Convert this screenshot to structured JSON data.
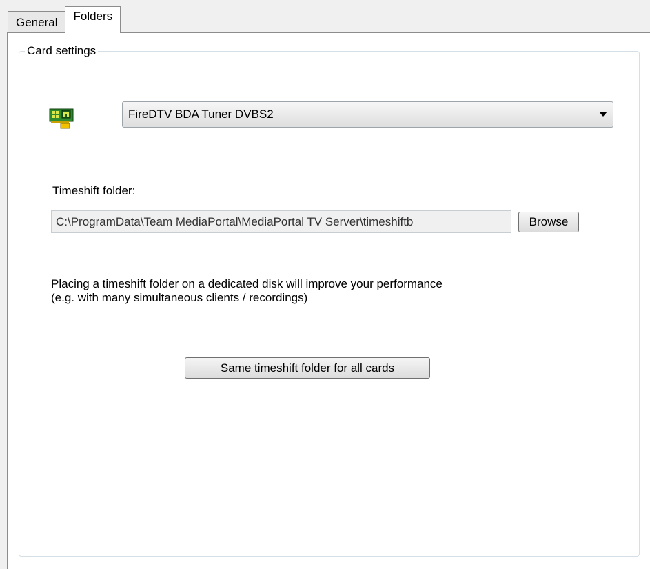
{
  "tabs": [
    {
      "label": "General",
      "active": false
    },
    {
      "label": "Folders",
      "active": true
    }
  ],
  "card_settings": {
    "group_title": "Card settings",
    "card_icon": "tuner-card-icon",
    "card_dropdown": {
      "selected": "FireDTV BDA Tuner DVBS2"
    },
    "timeshift_label": "Timeshift folder:",
    "timeshift_path": "C:\\ProgramData\\Team MediaPortal\\MediaPortal TV Server\\timeshiftb",
    "browse_label": "Browse",
    "info_line1": "Placing a timeshift folder on a dedicated disk will improve your performance",
    "info_line2": "(e.g. with many simultaneous clients / recordings)",
    "same_folder_button": "Same timeshift folder for all cards"
  }
}
